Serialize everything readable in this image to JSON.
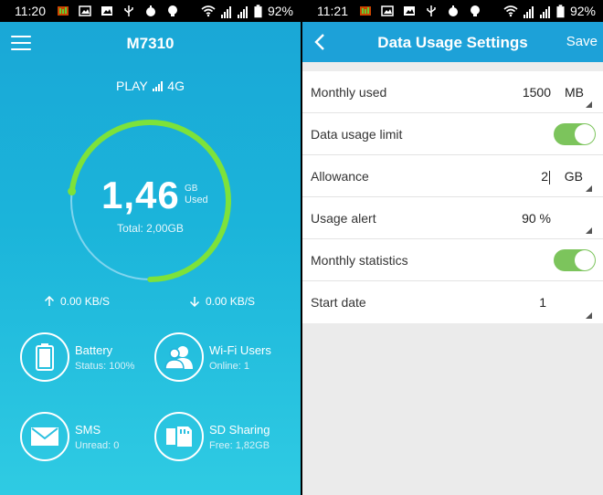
{
  "left_screen": {
    "status": {
      "time": "11:20",
      "battery": "92%"
    },
    "device_name": "M7310",
    "operator": {
      "name": "PLAY",
      "network": "4G"
    },
    "usage": {
      "amount": "1,46",
      "unit": "GB",
      "used_label": "Used",
      "total": "Total: 2,00GB",
      "fraction_used": 0.73
    },
    "upload_speed": "0.00 KB/S",
    "download_speed": "0.00 KB/S",
    "tiles": [
      {
        "icon": "battery-icon",
        "title": "Battery",
        "subtitle": "Status: 100%"
      },
      {
        "icon": "wifi-users-icon",
        "title": "Wi-Fi Users",
        "subtitle": "Online: 1"
      },
      {
        "icon": "sms-icon",
        "title": "SMS",
        "subtitle": "Unread: 0"
      },
      {
        "icon": "sd-card-icon",
        "title": "SD Sharing",
        "subtitle": "Free: 1,82GB"
      }
    ],
    "colors": {
      "accent_green": "#7de23a",
      "gradient_top": "#1aa6d6",
      "gradient_bottom": "#2fcbe3"
    }
  },
  "right_screen": {
    "status": {
      "time": "11:21",
      "battery": "92%"
    },
    "title": "Data Usage Settings",
    "save_label": "Save",
    "rows": {
      "monthly_used": {
        "label": "Monthly used",
        "value": "1500",
        "unit": "MB"
      },
      "data_usage_limit": {
        "label": "Data usage limit",
        "enabled": true
      },
      "allowance": {
        "label": "Allowance",
        "value": "2",
        "unit": "GB"
      },
      "usage_alert": {
        "label": "Usage alert",
        "value": "90 %"
      },
      "monthly_statistics": {
        "label": "Monthly statistics",
        "enabled": true
      },
      "start_date": {
        "label": "Start date",
        "value": "1"
      }
    },
    "colors": {
      "header": "#1da1d8",
      "toggle_on": "#7cc45c"
    }
  }
}
